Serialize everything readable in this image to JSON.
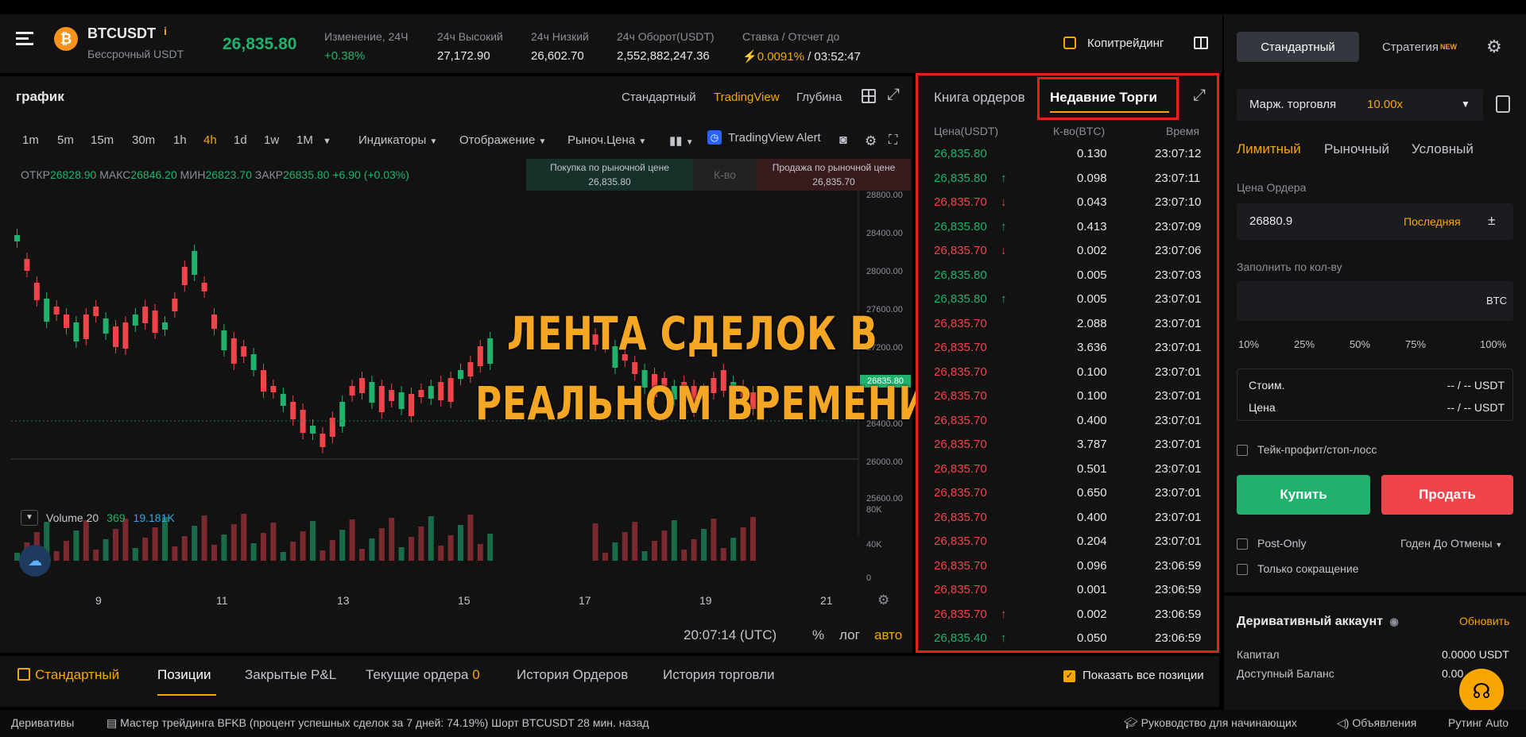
{
  "header": {
    "symbol": "BTCUSDT",
    "symbol_sub": "Бессрочный USDT",
    "last_price": "26,835.80",
    "stats": [
      {
        "label": "Изменение, 24Ч",
        "value": "+0.38%"
      },
      {
        "label": "24ч Высокий",
        "value": "27,172.90"
      },
      {
        "label": "24ч Низкий",
        "value": "26,602.70"
      },
      {
        "label": "24ч Оборот(USDT)",
        "value": "2,552,882,247.36"
      }
    ],
    "funding_label": "Ставка / Отсчет до",
    "funding_rate": "0.0091%",
    "funding_countdown": "/ 03:52:47",
    "copytrading": "Копитрейдинг"
  },
  "chart": {
    "title": "график",
    "views": [
      "Стандартный",
      "TradingView",
      "Глубина"
    ],
    "active_view": "TradingView",
    "timeframes": [
      "1m",
      "5m",
      "15m",
      "30m",
      "1h",
      "4h",
      "1d",
      "1w",
      "1M"
    ],
    "active_tf": "4h",
    "tools": [
      "Индикаторы",
      "Отображение",
      "Рыноч.Цена"
    ],
    "alert": "TradingView Alert",
    "ohlc": {
      "open_label": "ОТКР",
      "open": "26828.90",
      "high_label": "МАКС",
      "high": "26846.20",
      "low_label": "МИН",
      "low": "26823.70",
      "close_label": "ЗАКР",
      "close": "26835.80",
      "change": "+6.90 (+0.03%)"
    },
    "quick_buy_label": "Покупка по рыночной цене",
    "quick_buy_price": "26,835.80",
    "quick_qty": "К-во",
    "quick_sell_label": "Продажа по рыночной цене",
    "quick_sell_price": "26,835.70",
    "price_ticks": [
      "28800.00",
      "28400.00",
      "28000.00",
      "27600.00",
      "27200.00",
      "26400.00",
      "26000.00",
      "25600.00"
    ],
    "current_price_tag": "26835.80",
    "volume_label": "Volume 20",
    "volume_v1": "369",
    "volume_v2": "19.181K",
    "volume_ticks": [
      "80K",
      "40K",
      "0"
    ],
    "date_ticks": [
      "9",
      "11",
      "13",
      "15",
      "17",
      "19",
      "21"
    ],
    "clock": "20:07:14 (UTC)",
    "scale_opts": [
      "%",
      "лог",
      "авто"
    ]
  },
  "overlay": {
    "line1": "ЛЕНТА СДЕЛОК В",
    "line2": "РЕАЛЬНОМ ВРЕМЕНИ"
  },
  "trades": {
    "tab_book": "Книга ордеров",
    "tab_recent": "Недавние Торги",
    "col_price": "Цена(USDT)",
    "col_qty": "К-во(BTC)",
    "col_time": "Время",
    "rows": [
      {
        "price": "26,835.80",
        "qty": "0.130",
        "time": "23:07:12",
        "side": "buy",
        "arrow": ""
      },
      {
        "price": "26,835.80",
        "qty": "0.098",
        "time": "23:07:11",
        "side": "buy",
        "arrow": "↑"
      },
      {
        "price": "26,835.70",
        "qty": "0.043",
        "time": "23:07:10",
        "side": "sell",
        "arrow": "↓"
      },
      {
        "price": "26,835.80",
        "qty": "0.413",
        "time": "23:07:09",
        "side": "buy",
        "arrow": "↑"
      },
      {
        "price": "26,835.70",
        "qty": "0.002",
        "time": "23:07:06",
        "side": "sell",
        "arrow": "↓"
      },
      {
        "price": "26,835.80",
        "qty": "0.005",
        "time": "23:07:03",
        "side": "buy",
        "arrow": ""
      },
      {
        "price": "26,835.80",
        "qty": "0.005",
        "time": "23:07:01",
        "side": "buy",
        "arrow": "↑"
      },
      {
        "price": "26,835.70",
        "qty": "2.088",
        "time": "23:07:01",
        "side": "sell",
        "arrow": ""
      },
      {
        "price": "26,835.70",
        "qty": "3.636",
        "time": "23:07:01",
        "side": "sell",
        "arrow": ""
      },
      {
        "price": "26,835.70",
        "qty": "0.100",
        "time": "23:07:01",
        "side": "sell",
        "arrow": ""
      },
      {
        "price": "26,835.70",
        "qty": "0.100",
        "time": "23:07:01",
        "side": "sell",
        "arrow": ""
      },
      {
        "price": "26,835.70",
        "qty": "0.400",
        "time": "23:07:01",
        "side": "sell",
        "arrow": ""
      },
      {
        "price": "26,835.70",
        "qty": "3.787",
        "time": "23:07:01",
        "side": "sell",
        "arrow": ""
      },
      {
        "price": "26,835.70",
        "qty": "0.501",
        "time": "23:07:01",
        "side": "sell",
        "arrow": ""
      },
      {
        "price": "26,835.70",
        "qty": "0.650",
        "time": "23:07:01",
        "side": "sell",
        "arrow": ""
      },
      {
        "price": "26,835.70",
        "qty": "0.400",
        "time": "23:07:01",
        "side": "sell",
        "arrow": ""
      },
      {
        "price": "26,835.70",
        "qty": "0.204",
        "time": "23:07:01",
        "side": "sell",
        "arrow": ""
      },
      {
        "price": "26,835.70",
        "qty": "0.096",
        "time": "23:06:59",
        "side": "sell",
        "arrow": ""
      },
      {
        "price": "26,835.70",
        "qty": "0.001",
        "time": "23:06:59",
        "side": "sell",
        "arrow": ""
      },
      {
        "price": "26,835.70",
        "qty": "0.002",
        "time": "23:06:59",
        "side": "sell",
        "arrow": "↑"
      },
      {
        "price": "26,835.40",
        "qty": "0.050",
        "time": "23:06:59",
        "side": "buy",
        "arrow": "↑"
      }
    ]
  },
  "order_form": {
    "tab_standard": "Стандартный",
    "tab_strategy": "Стратегия",
    "new_badge": "NEW",
    "margin_label": "Марж. торговля",
    "leverage": "10.00x",
    "order_types": [
      "Лимитный",
      "Рыночный",
      "Условный"
    ],
    "price_label": "Цена Ордера",
    "price_value": "26880.9",
    "last_label": "Последняя",
    "qty_label": "Заполнить по кол-ву",
    "qty_unit": "BTC",
    "percents": [
      "10%",
      "25%",
      "50%",
      "75%",
      "100%"
    ],
    "cost_label": "Стоим.",
    "cost_value": "-- / -- USDT",
    "price2_label": "Цена",
    "price2_value": "-- / -- USDT",
    "tpsl_label": "Тейк-профит/стоп-лосс",
    "buy_label": "Купить",
    "sell_label": "Продать",
    "post_only": "Post-Only",
    "tif": "Годен До Отмены",
    "reduce_only": "Только сокращение",
    "account_title": "Деривативный аккаунт",
    "refresh": "Обновить",
    "capital_label": "Капитал",
    "capital_value": "0.0000 USDT",
    "avail_label": "Доступный Баланс",
    "avail_value": "0.00"
  },
  "bottom_tabs": {
    "standard": "Стандартный",
    "tabs": [
      "Позиции",
      "Закрытые P&L",
      "Текущие ордера",
      "История Ордеров",
      "История торговли"
    ],
    "open_orders_count": "0",
    "show_all": "Показать все позиции"
  },
  "footer": {
    "left": "Деривативы",
    "ticker": "Мастер трейдинга BFKB (процент успешных сделок за 7 дней: 74.19%) Шорт BTCUSDT 28 мин. назад",
    "guide": "Руководство для начинающих",
    "news": "Объявления",
    "routing": "Рутинг Auto"
  },
  "colors": {
    "up": "#20b26c",
    "down": "#ef454a",
    "accent": "#f7a600",
    "highlight": "#e3201b"
  }
}
